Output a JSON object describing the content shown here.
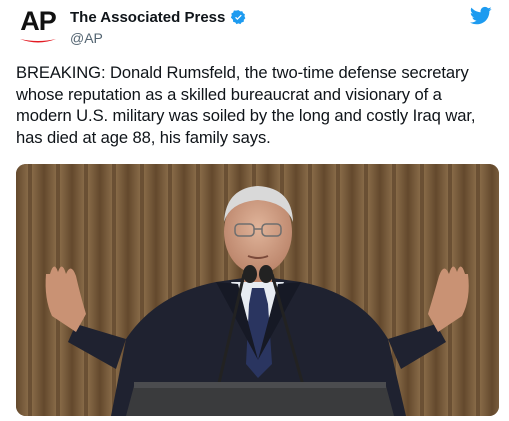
{
  "account": {
    "display_name": "The Associated Press",
    "handle": "@AP",
    "avatar_letters": "AP",
    "verified": true
  },
  "tweet": {
    "text": "BREAKING: Donald Rumsfeld, the two-time defense secretary whose reputation as a skilled bureaucrat and visionary of a modern U.S. military was soiled by the long and costly Iraq war, has died at age 88, his family says."
  },
  "icons": {
    "verified": "verified-badge-icon",
    "brand": "twitter-bird-icon"
  },
  "colors": {
    "verified": "#1d9bf0",
    "twitter_blue": "#1d9bf0",
    "ap_red": "#e31b23"
  }
}
